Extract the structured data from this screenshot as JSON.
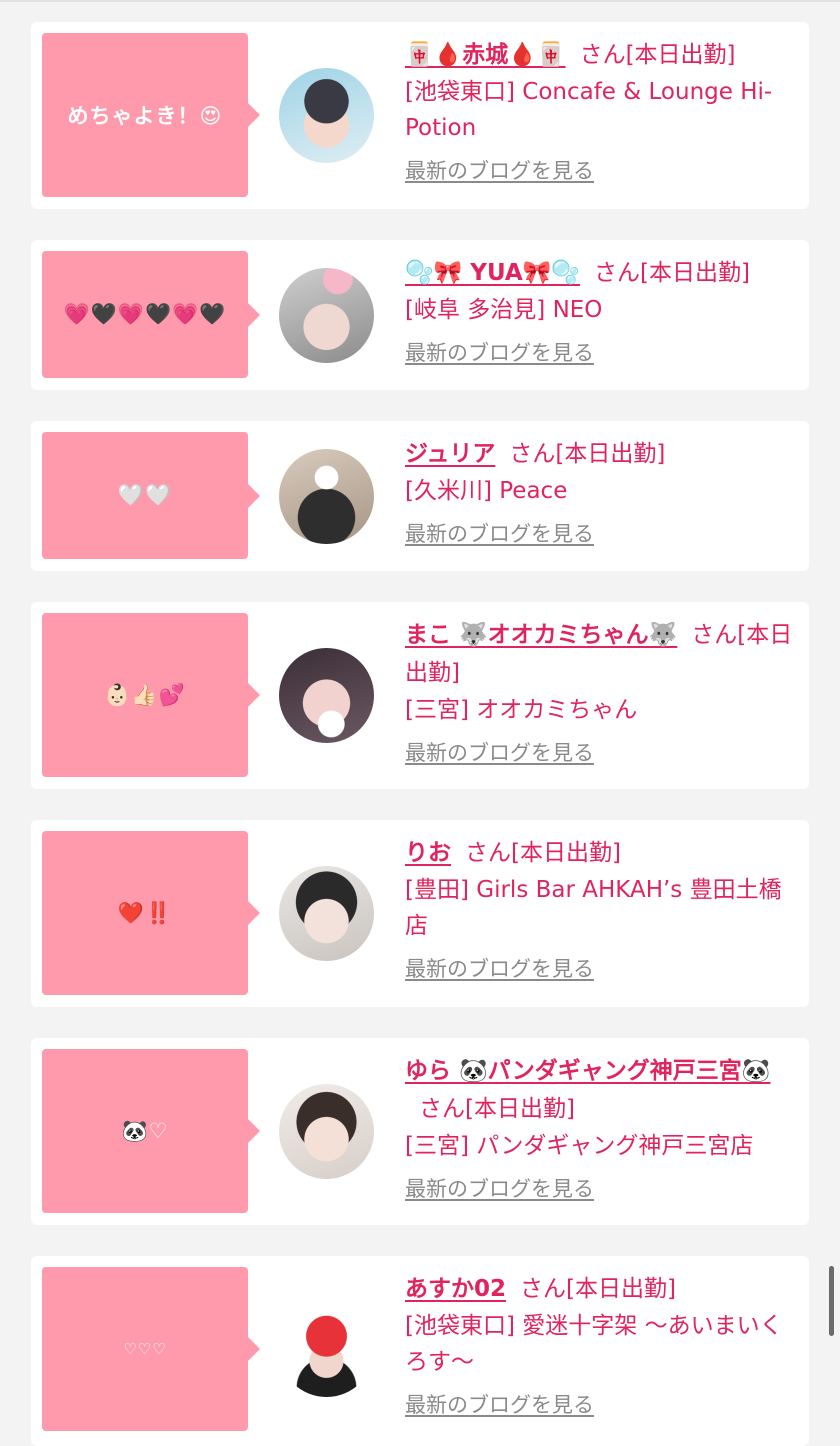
{
  "san_label": "さん",
  "status_label": "[本日出勤]",
  "blog_link_label": "最新のブログを見る",
  "cards": [
    {
      "bubble": "めちゃよき！😍",
      "name": "🀄🩸赤城🩸🀄",
      "store": "[池袋東口] Concafe & Lounge Hi-Potion"
    },
    {
      "bubble": "💗🖤💗🖤💗🖤",
      "name": "🫧🎀 YUA🎀🫧",
      "store": "[岐阜 多治見] NEO"
    },
    {
      "bubble": "🤍🤍",
      "name": "ジュリア",
      "store": "[久米川] Peace"
    },
    {
      "bubble": "👶🏻👍🏻💕",
      "name": "まこ 🐺オオカミちゃん🐺",
      "store": "[三宮] オオカミちゃん"
    },
    {
      "bubble": "❤️‼️",
      "name": "りお",
      "store": "[豊田] Girls Bar AHKAH’s 豊田土橋店"
    },
    {
      "bubble": "🐼♡",
      "name": "ゆら 🐼パンダギャング神戸三宮🐼",
      "store": "[三宮] パンダギャング神戸三宮店"
    },
    {
      "bubble": "♡♡♡",
      "name": "あすか02",
      "store": "[池袋東口] 愛迷十字架 〜あいまいくろす〜"
    }
  ],
  "colors": {
    "accent": "#e0245e",
    "bubble": "#ff9aac",
    "muted": "#8a8a8a",
    "background": "#f3f3f3"
  }
}
